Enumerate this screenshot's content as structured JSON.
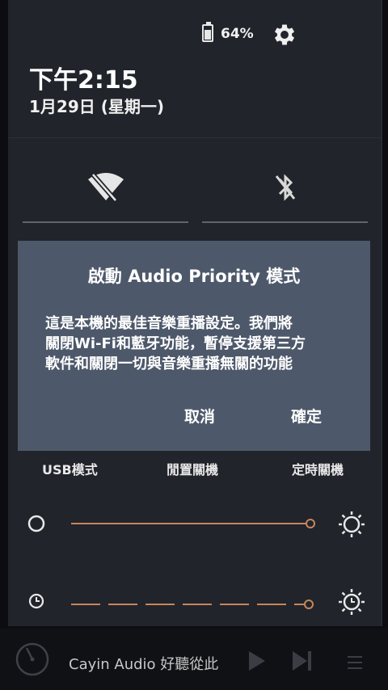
{
  "status": {
    "battery_percent": "64%",
    "battery_level": 0.64
  },
  "header": {
    "time": "下午2:15",
    "date": "1月29日 (星期一)"
  },
  "tiles": [
    {
      "name": "wifi",
      "icon": "wifi-off-icon",
      "state": "off"
    },
    {
      "name": "bluetooth",
      "icon": "bluetooth-off-icon",
      "state": "off"
    }
  ],
  "dialog": {
    "title": "啟動 Audio Priority 模式",
    "body": "這是本機的最佳音樂重播設定。我們將\n關閉Wi-Fi和藍牙功能，暫停支援第三方\n軟件和關閉一切與音樂重播無關的功能",
    "cancel_label": "取消",
    "ok_label": "確定"
  },
  "modes": {
    "usb": "USB模式",
    "idle_off": "閒置關機",
    "timer_off": "定時關機"
  },
  "sliders": [
    {
      "name": "brightness",
      "value": 1.0,
      "icon_left": "circle-icon",
      "icon_right": "brightness-icon"
    },
    {
      "name": "screen-timeout",
      "value": 0.99,
      "icon_left": "clock-icon",
      "icon_right": "timer-brightness-icon"
    }
  ],
  "player": {
    "track_text": "Cayin Audio 好聽從此",
    "icons": [
      "disc-icon",
      "play-icon",
      "next-icon",
      "menu-icon"
    ]
  },
  "colors": {
    "accent": "#c8855a",
    "dialog_bg": "#4d586a",
    "panel_bg": "#21242b"
  }
}
